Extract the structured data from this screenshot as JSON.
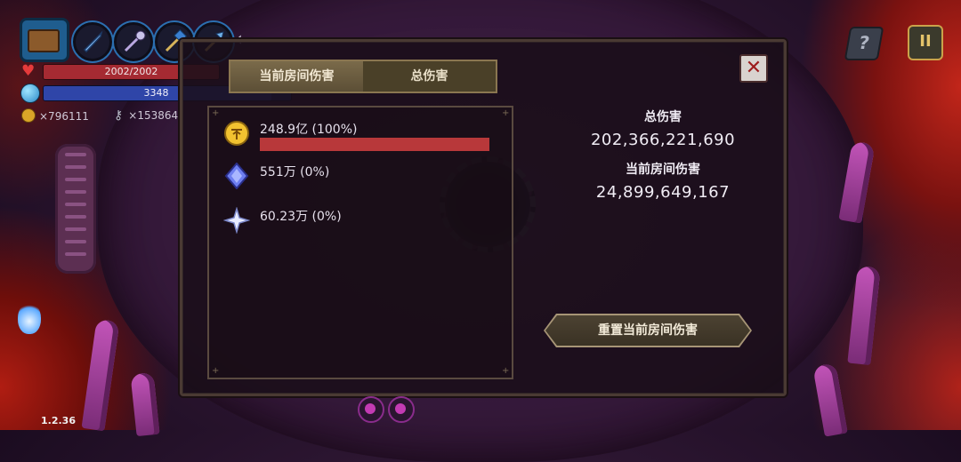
{
  "hud": {
    "hp_text": "2002/2002",
    "hp_fraction": 1.0,
    "mp_text": "3348",
    "mp_fraction": 0.92,
    "coins": "×796111",
    "keys": "×153864",
    "weapon_icons": [
      "sword-icon",
      "staff-icon",
      "hammer-icon",
      "wand-icon"
    ]
  },
  "dialog": {
    "tabs": [
      {
        "label": "当前房间伤害",
        "active": true
      },
      {
        "label": "总伤害",
        "active": false
      }
    ],
    "sources": [
      {
        "icon": "gold-rune-icon",
        "label": "248.9亿 (100%)",
        "fraction": 1.0
      },
      {
        "icon": "blue-crystal-icon",
        "label": "551万 (0%)",
        "fraction": 0.0
      },
      {
        "icon": "white-star-icon",
        "label": "60.23万 (0%)",
        "fraction": 0.0
      }
    ],
    "total_damage_label": "总伤害",
    "total_damage_value": "202,366,221,690",
    "room_damage_label": "当前房间伤害",
    "room_damage_value": "24,899,649,167",
    "reset_button": "重置当前房间伤害",
    "close_glyph": "✕"
  },
  "ui": {
    "help_glyph": "?",
    "pause_glyph": "II",
    "version": "1.2.36"
  }
}
